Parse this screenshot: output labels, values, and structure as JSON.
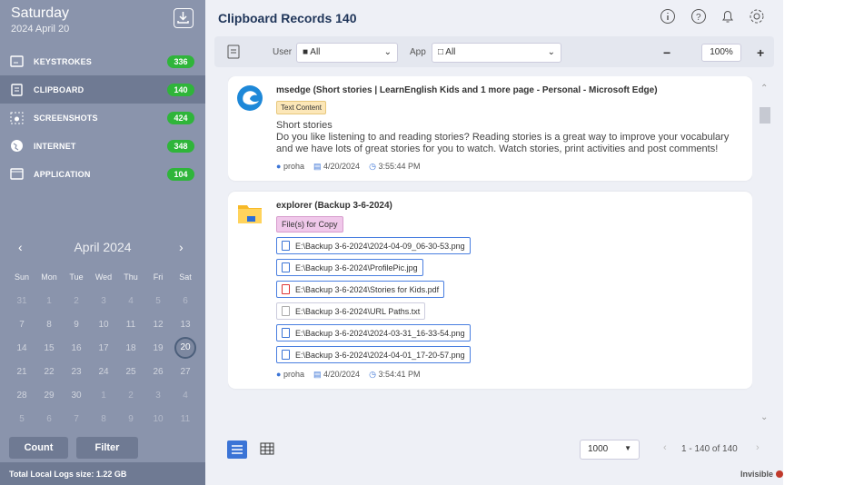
{
  "sidebar": {
    "day": "Saturday",
    "date": "2024 April 20",
    "nav": [
      {
        "label": "KEYSTROKES",
        "count": "336"
      },
      {
        "label": "CLIPBOARD",
        "count": "140"
      },
      {
        "label": "SCREENSHOTS",
        "count": "424"
      },
      {
        "label": "INTERNET",
        "count": "348"
      },
      {
        "label": "APPLICATION",
        "count": "104"
      }
    ],
    "calendar": {
      "month": "April 2024",
      "prev": "‹",
      "next": "›",
      "dow": [
        "Sun",
        "Mon",
        "Tue",
        "Wed",
        "Thu",
        "Fri",
        "Sat"
      ],
      "weeks": [
        [
          "31",
          "1",
          "2",
          "3",
          "4",
          "5",
          "6"
        ],
        [
          "7",
          "8",
          "9",
          "10",
          "11",
          "12",
          "13"
        ],
        [
          "14",
          "15",
          "16",
          "17",
          "18",
          "19",
          "20"
        ],
        [
          "21",
          "22",
          "23",
          "24",
          "25",
          "26",
          "27"
        ],
        [
          "28",
          "29",
          "30",
          "1",
          "2",
          "3",
          "4"
        ],
        [
          "5",
          "6",
          "7",
          "8",
          "9",
          "10",
          "11"
        ]
      ]
    },
    "count_label": "Count",
    "filter_label": "Filter",
    "footer": "Total Local Logs size: 1.22 GB"
  },
  "main": {
    "title": "Clipboard Records 140",
    "toolbar": {
      "user_label": "User",
      "user_value": "All",
      "app_label": "App",
      "app_value": "All",
      "zoom_minus": "−",
      "zoom": "100%",
      "zoom_plus": "+"
    },
    "records": [
      {
        "title": "msedge (Short stories | LearnEnglish Kids and 1 more page - Personal - Microsoft Edge)",
        "tag": "Text Content",
        "line1": "Short stories",
        "body": "Do you like listening to and reading stories? Reading stories is a great way to improve your vocabulary and we have lots of great stories for you to watch. Watch stories, print activities and post comments!",
        "user": "proha",
        "date": "4/20/2024",
        "time": "3:55:44 PM"
      },
      {
        "title": "explorer (Backup 3-6-2024)",
        "tag": "File(s) for Copy",
        "files": [
          "E:\\Backup 3-6-2024\\2024-04-09_06-30-53.png",
          "E:\\Backup 3-6-2024\\ProfilePic.jpg",
          "E:\\Backup 3-6-2024\\Stories for Kids.pdf",
          "E:\\Backup 3-6-2024\\URL Paths.txt",
          "E:\\Backup 3-6-2024\\2024-03-31_16-33-54.png",
          "E:\\Backup 3-6-2024\\2024-04-01_17-20-57.png"
        ],
        "user": "proha",
        "date": "4/20/2024",
        "time": "3:54:41 PM"
      }
    ],
    "page_size": "1000",
    "page_info": "1 - 140 of 140",
    "invisible": "Invisible"
  }
}
